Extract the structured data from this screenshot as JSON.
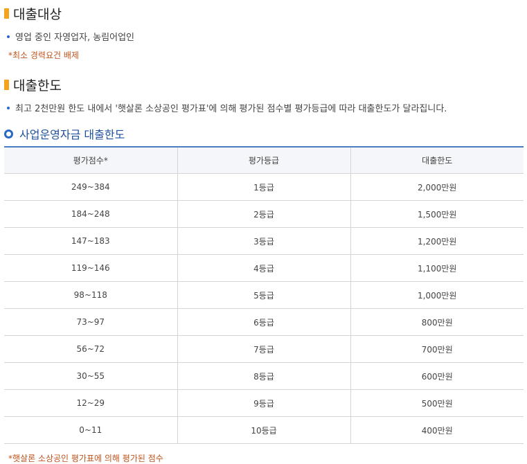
{
  "section1": {
    "title": "대출대상",
    "bullet": "영업 중인 자영업자, 농림어업인",
    "note": "*최소 경력요건 배제"
  },
  "section2": {
    "title": "대출한도",
    "bullet": "최고 2천만원 한도 내에서 '햇살론 소상공인 평가표'에 의해 평가된 점수별 평가등급에 따라 대출한도가 달라집니다."
  },
  "subsection": {
    "title": "사업운영자금 대출한도"
  },
  "table": {
    "headers": [
      "평가점수*",
      "평가등급",
      "대출한도"
    ],
    "rows": [
      [
        "249~384",
        "1등급",
        "2,000만원"
      ],
      [
        "184~248",
        "2등급",
        "1,500만원"
      ],
      [
        "147~183",
        "3등급",
        "1,200만원"
      ],
      [
        "119~146",
        "4등급",
        "1,100만원"
      ],
      [
        "98~118",
        "5등급",
        "1,000만원"
      ],
      [
        "73~97",
        "6등급",
        "800만원"
      ],
      [
        "56~72",
        "7등급",
        "700만원"
      ],
      [
        "30~55",
        "8등급",
        "600만원"
      ],
      [
        "12~29",
        "9등급",
        "500만원"
      ],
      [
        "0~11",
        "10등급",
        "400만원"
      ]
    ]
  },
  "footnote": "*햇살론 소상공인 평가표에 의해 평가된 점수",
  "colors": {
    "accent_orange": "#f5a21c",
    "accent_blue": "#2a66c4",
    "note_red": "#c0531c"
  }
}
